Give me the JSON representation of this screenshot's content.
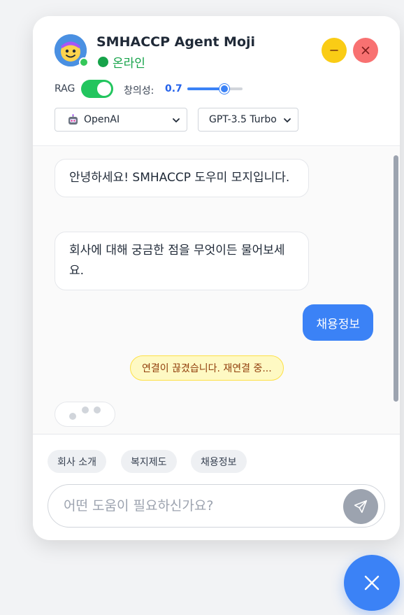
{
  "header": {
    "title": "SMHACCP Agent Moji",
    "status": "온라인",
    "avatar_icon": "moji-avatar-icon",
    "minimize_icon": "minus-icon",
    "close_icon": "close-icon"
  },
  "settings": {
    "rag_label": "RAG",
    "rag_enabled": true,
    "creativity_label": "창의성:",
    "creativity_value": "0.7",
    "creativity": 0.7,
    "provider": "OpenAI",
    "provider_icon": "robot-icon",
    "model": "GPT-3.5 Turbo"
  },
  "messages": {
    "bot1": "안녕하세요! SMHACCP 도우미 모지입니다.",
    "bot2": "회사에 대해 궁금한 점을 무엇이든 물어보세요.",
    "user1": "채용정보",
    "warning": "연결이 끊겼습니다. 재연결 중..."
  },
  "quick_replies": [
    "회사 소개",
    "복지제도",
    "채용정보"
  ],
  "input": {
    "placeholder": "어떤 도움이 필요하신가요?",
    "value": "",
    "send_icon": "send-icon"
  },
  "fab": {
    "icon": "close-icon"
  },
  "colors": {
    "accent": "#3b82f6",
    "online": "#16a34a",
    "toggle_on": "#22c55e",
    "minimize": "#facc15",
    "close": "#f87171",
    "warning_bg": "#fef9c3"
  }
}
